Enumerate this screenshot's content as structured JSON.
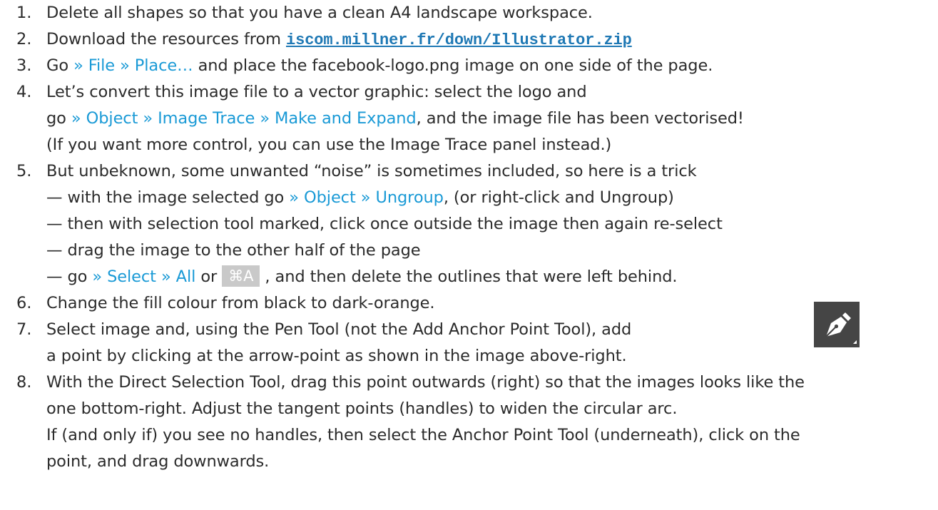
{
  "steps": [
    {
      "num": "1.",
      "lines": [
        {
          "t": "Delete all shapes so that you have a clean A4 landscape workspace."
        }
      ]
    },
    {
      "num": "2.",
      "lines": [
        {
          "pre": "Download the resources from ",
          "link": "iscom.millner.fr/down/Illustrator.zip"
        }
      ]
    },
    {
      "num": "3.",
      "lines": [
        {
          "pre": "Go ",
          "menu": "» File » Place…",
          "post": " and place the facebook-logo.png image on one side of the page."
        }
      ]
    },
    {
      "num": "4.",
      "lines": [
        {
          "t": "Let’s convert this image file to a vector graphic: select the logo and"
        },
        {
          "pre": "go ",
          "menu": "» Object » Image Trace » Make and Expand",
          "post": ", and the image file has been vectorised!"
        },
        {
          "t": "(If you want more control, you can use the Image Trace panel instead.)"
        }
      ]
    },
    {
      "num": "5.",
      "lines": [
        {
          "t": "But unbeknown, some unwanted “noise” is sometimes included, so here is a trick"
        },
        {
          "pre": "— with the image selected go ",
          "menu": "» Object » Ungroup",
          "post": ", (or right-click and Ungroup)"
        },
        {
          "t": "— then with selection tool marked, click once outside the image then again re-select"
        },
        {
          "t": "— drag the image to the other half of the page"
        },
        {
          "pre": "— go ",
          "menu": "» Select » All",
          "mid": " or ",
          "kbd_cmd": "⌘",
          "kbd_key": "A",
          "post": " , and then delete the outlines that were left behind."
        }
      ]
    },
    {
      "num": "6.",
      "lines": [
        {
          "t": "Change the fill colour from black to dark-orange."
        }
      ]
    },
    {
      "num": "7.",
      "lines": [
        {
          "t": "Select image and, using the Pen Tool (not the Add Anchor Point Tool), add"
        },
        {
          "t": "a point by clicking at the arrow-point as shown in the image above-right."
        }
      ]
    },
    {
      "num": "8.",
      "lines": [
        {
          "t": "With the Direct Selection Tool, drag this point outwards (right) so that the images looks like the"
        },
        {
          "t": "one bottom-right. Adjust the tangent points (handles) to widen the circular arc."
        },
        {
          "t": "If (and only if) you see no handles, then select the Anchor Point Tool (underneath), click on the"
        },
        {
          "t": "point, and drag downwards."
        }
      ]
    }
  ],
  "icons": {
    "pen_tool": "pen-tool-icon"
  },
  "colors": {
    "menu": "#1a9ad6",
    "link": "#1e78b4",
    "text": "#2b2b2b",
    "kbd_bg": "#c9c9c9",
    "icon_bg": "#454545"
  }
}
